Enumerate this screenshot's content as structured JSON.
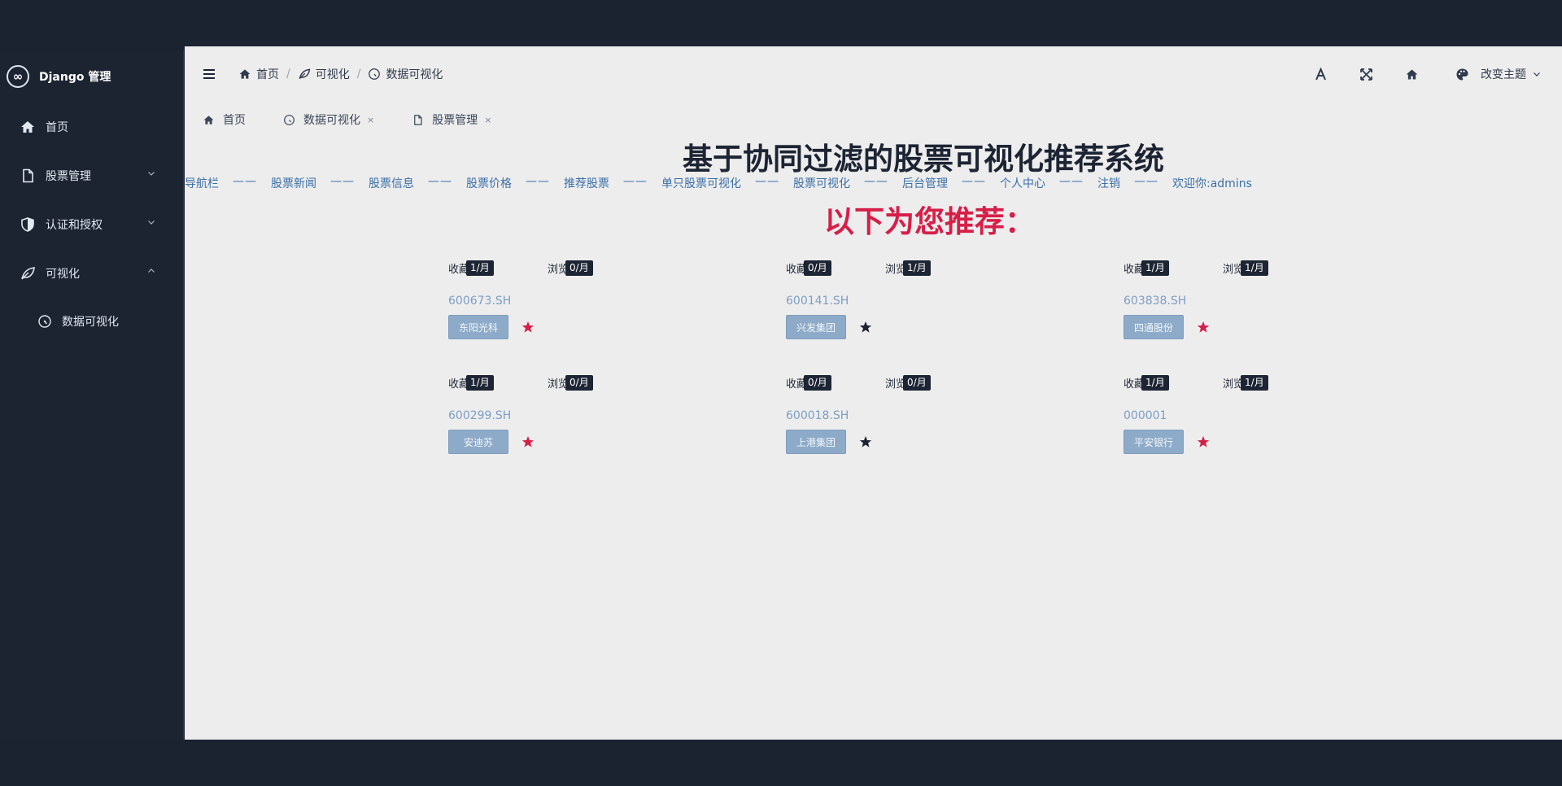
{
  "sidebar": {
    "brand": "Django 管理",
    "items": [
      {
        "label": "首页"
      },
      {
        "label": "股票管理"
      },
      {
        "label": "认证和授权"
      },
      {
        "label": "可视化"
      }
    ],
    "sub_item": "数据可视化"
  },
  "breadcrumb": [
    "首页",
    "可视化",
    "数据可视化"
  ],
  "header": {
    "theme_label": "改变主题"
  },
  "tabs": [
    {
      "label": "首页"
    },
    {
      "label": "数据可视化",
      "close": "×"
    },
    {
      "label": "股票管理",
      "close": "×"
    }
  ],
  "page": {
    "title": "基于协同过滤的股票可视化推荐系统",
    "recommend_heading": "以下为您推荐：",
    "nav_links": [
      "导航栏",
      "股票新闻",
      "股票信息",
      "股票价格",
      "推荐股票",
      "单只股票可视化",
      "股票可视化",
      "后台管理",
      "个人中心",
      "注销",
      "欢迎你:admins"
    ],
    "nav_sep": "——"
  },
  "stocks": [
    {
      "fav_label": "收藏",
      "fav": "1/月",
      "view_label": "浏览",
      "view": "0/月",
      "code": "600673.SH",
      "name": "东阳光科",
      "star": "#d61f48"
    },
    {
      "fav_label": "收藏",
      "fav": "0/月",
      "view_label": "浏览",
      "view": "1/月",
      "code": "600141.SH",
      "name": "兴发集团",
      "star": "#1d2433"
    },
    {
      "fav_label": "收藏",
      "fav": "1/月",
      "view_label": "浏览",
      "view": "1/月",
      "code": "603838.SH",
      "name": "四通股份",
      "star": "#d61f48"
    },
    {
      "fav_label": "收藏",
      "fav": "1/月",
      "view_label": "浏览",
      "view": "0/月",
      "code": "600299.SH",
      "name": "安迪苏",
      "star": "#d61f48"
    },
    {
      "fav_label": "收藏",
      "fav": "0/月",
      "view_label": "浏览",
      "view": "0/月",
      "code": "600018.SH",
      "name": "上港集团",
      "star": "#1d2433"
    },
    {
      "fav_label": "收藏",
      "fav": "1/月",
      "view_label": "浏览",
      "view": "1/月",
      "code": "000001",
      "name": "平安银行",
      "star": "#d61f48"
    }
  ]
}
